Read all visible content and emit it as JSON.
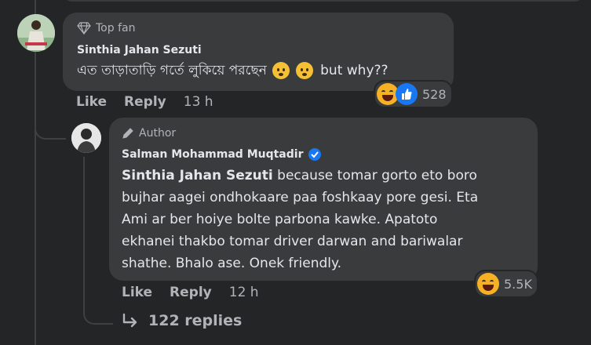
{
  "comment": {
    "badge": "Top fan",
    "author": "Sinthia Jahan Sezuti",
    "text_bn": "এত তাড়াতাড়ি গর্তে লুকিয়ে পরছেন",
    "text_tail": "but why??",
    "actions": {
      "like": "Like",
      "reply": "Reply",
      "time": "13 h"
    },
    "reactions": {
      "count": "528",
      "types": [
        "haha",
        "like"
      ]
    }
  },
  "reply": {
    "badge": "Author",
    "author": "Salman Mohammad Muqtadir",
    "verified": true,
    "mention": "Sinthia Jahan Sezuti",
    "lines": [
      " because tomar gorto eto boro",
      "bujhar aagei ondhokaare paa foshkaay pore gesi. Eta",
      "Ami ar ber hoiye bolte parbona kawke. Apatoto",
      "ekhanei thakbo tomar driver darwan and bariwalar",
      "shathe. Bhalo ase. Onek friendly."
    ],
    "actions": {
      "like": "Like",
      "reply": "Reply",
      "time": "12 h"
    },
    "reactions": {
      "count": "5.5K",
      "types": [
        "haha"
      ]
    }
  },
  "more_replies": {
    "label": "122 replies"
  },
  "colors": {
    "bg": "#242526",
    "bubble": "#3a3b3c",
    "text": "#e4e6eb",
    "muted": "#b0b3b8",
    "verified": "#1877f2"
  }
}
